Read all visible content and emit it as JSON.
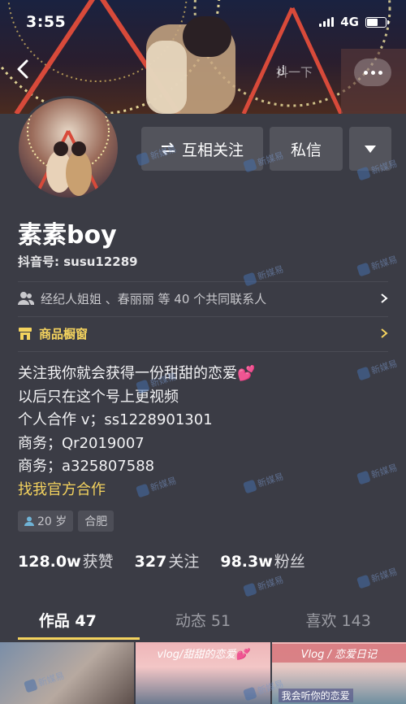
{
  "status_bar": {
    "time": "3:55",
    "network": "4G"
  },
  "cover": {
    "watermark_text": "抖一下"
  },
  "actions": {
    "follow_label": "互相关注",
    "message_label": "私信"
  },
  "profile": {
    "name": "素素boy",
    "douyin_id": "抖音号: susu12289"
  },
  "mutual_contacts": "经纪人姐姐 、春丽丽 等 40 个共同联系人",
  "shop_window": "商品橱窗",
  "bio": {
    "line1": "关注我你就会获得一份甜甜的恋爱💕",
    "line2": "以后只在这个号上更视频",
    "line3": "个人合作 v；ss1228901301",
    "line4": "商务；Qr2019007",
    "line5": "商务；a325807588",
    "link": "找我官方合作"
  },
  "tags": {
    "age": "20 岁",
    "city": "合肥"
  },
  "stats": {
    "likes_value": "128.0w",
    "likes_label": "获赞",
    "following_value": "327",
    "following_label": "关注",
    "followers_value": "98.3w",
    "followers_label": "粉丝"
  },
  "tabs": [
    {
      "label": "作品 47"
    },
    {
      "label": "动态 51"
    },
    {
      "label": "喜欢 143"
    }
  ],
  "videos": {
    "v2_title": "vlog/甜甜的恋爱💕",
    "v3_title": "Vlog / 恋爱日记",
    "v3_caption": "我会听你的恋爱"
  },
  "watermark": "新媒易",
  "colors": {
    "background": "#3b3c45",
    "accent_yellow": "#f4d35e",
    "button_bg": "#53545c"
  }
}
